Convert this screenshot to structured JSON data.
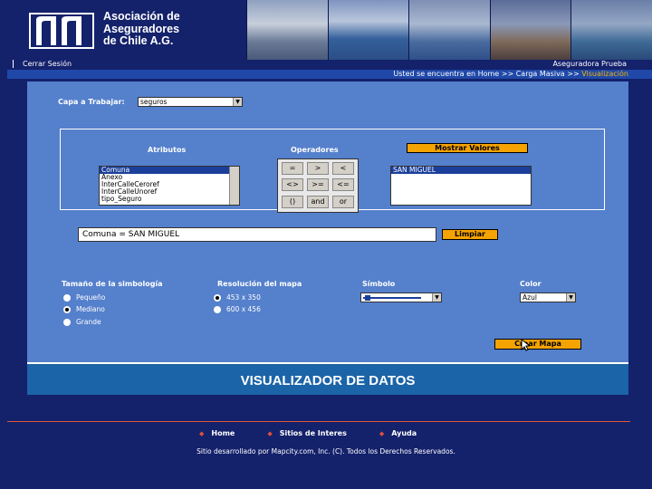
{
  "header": {
    "org_line1": "Asociación de",
    "org_line2": "Aseguradores",
    "org_line3": "de Chile A.G."
  },
  "topbar": {
    "logout": "Cerrar Sesión",
    "user": "Aseguradora Prueba",
    "breadcrumb_prefix": "Usted se encuentra en Home >> Carga Masiva >> ",
    "breadcrumb_active": "Visualización"
  },
  "form": {
    "layer_label": "Capa a Trabajar:",
    "layer_value": "seguros",
    "atributos_label": "Atributos",
    "operadores_label": "Operadores",
    "mostrar_valores": "Mostrar Valores",
    "atributos": [
      "Comuna",
      "Anexo",
      "InterCalleCeroref",
      "InterCalleUnoref",
      "tipo_Seguro"
    ],
    "valores": [
      "SAN MIGUEL"
    ],
    "operators": [
      "=",
      ">",
      "<",
      "<>",
      ">=",
      "<=",
      "()",
      "and",
      "or"
    ],
    "query": "Comuna = SAN MIGUEL",
    "limpiar": "Limpiar",
    "tamano_label": "Tamaño de la simbología",
    "tamano_options": [
      "Pequeño",
      "Mediano",
      "Grande"
    ],
    "tamano_selected": 1,
    "resolucion_label": "Resolución del mapa",
    "resolucion_options": [
      "453 x 350",
      "600 x 456"
    ],
    "resolucion_selected": 0,
    "simbolo_label": "Símbolo",
    "color_label": "Color",
    "color_value": "Azul",
    "color_hex": "#1b3f9a",
    "crear_mapa": "Crear Mapa"
  },
  "banner": {
    "title": "VISUALIZADOR DE DATOS"
  },
  "footer": {
    "nav": [
      "Home",
      "Sitios de Interes",
      "Ayuda"
    ],
    "copyright": "Sitio desarrollado por Mapcity.com, Inc. (C). Todos los Derechos Reservados."
  }
}
